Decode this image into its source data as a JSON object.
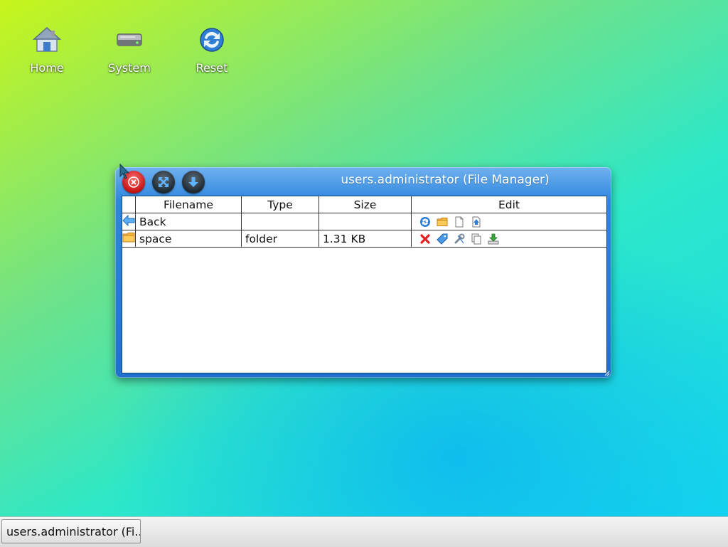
{
  "desktop": {
    "icons": [
      {
        "label": "Home",
        "icon": "home-icon"
      },
      {
        "label": "System",
        "icon": "drive-icon"
      },
      {
        "label": "Reset",
        "icon": "reset-icon"
      }
    ]
  },
  "window": {
    "title": "users.administrator (File Manager)",
    "buttons": [
      "close-icon",
      "maximize-icon",
      "minimize-icon"
    ],
    "table": {
      "headers": [
        "Filename",
        "Type",
        "Size",
        "Edit"
      ],
      "rows": [
        {
          "icon": "back-arrow-icon",
          "filename": "Back",
          "type": "",
          "size": "",
          "edit": [
            "refresh-icon",
            "new-folder-icon",
            "new-file-icon",
            "upload-icon"
          ]
        },
        {
          "icon": "folder-icon",
          "filename": "space",
          "type": "folder",
          "size": "1.31 KB",
          "edit": [
            "delete-icon",
            "rename-tag-icon",
            "properties-wrench-icon",
            "copy-icon",
            "download-icon"
          ]
        }
      ]
    }
  },
  "taskbar": {
    "items": [
      {
        "label": "users.administrator (Fi..."
      }
    ]
  },
  "colors": {
    "titlebar": "#2f86df",
    "close_button": "#c51414"
  }
}
